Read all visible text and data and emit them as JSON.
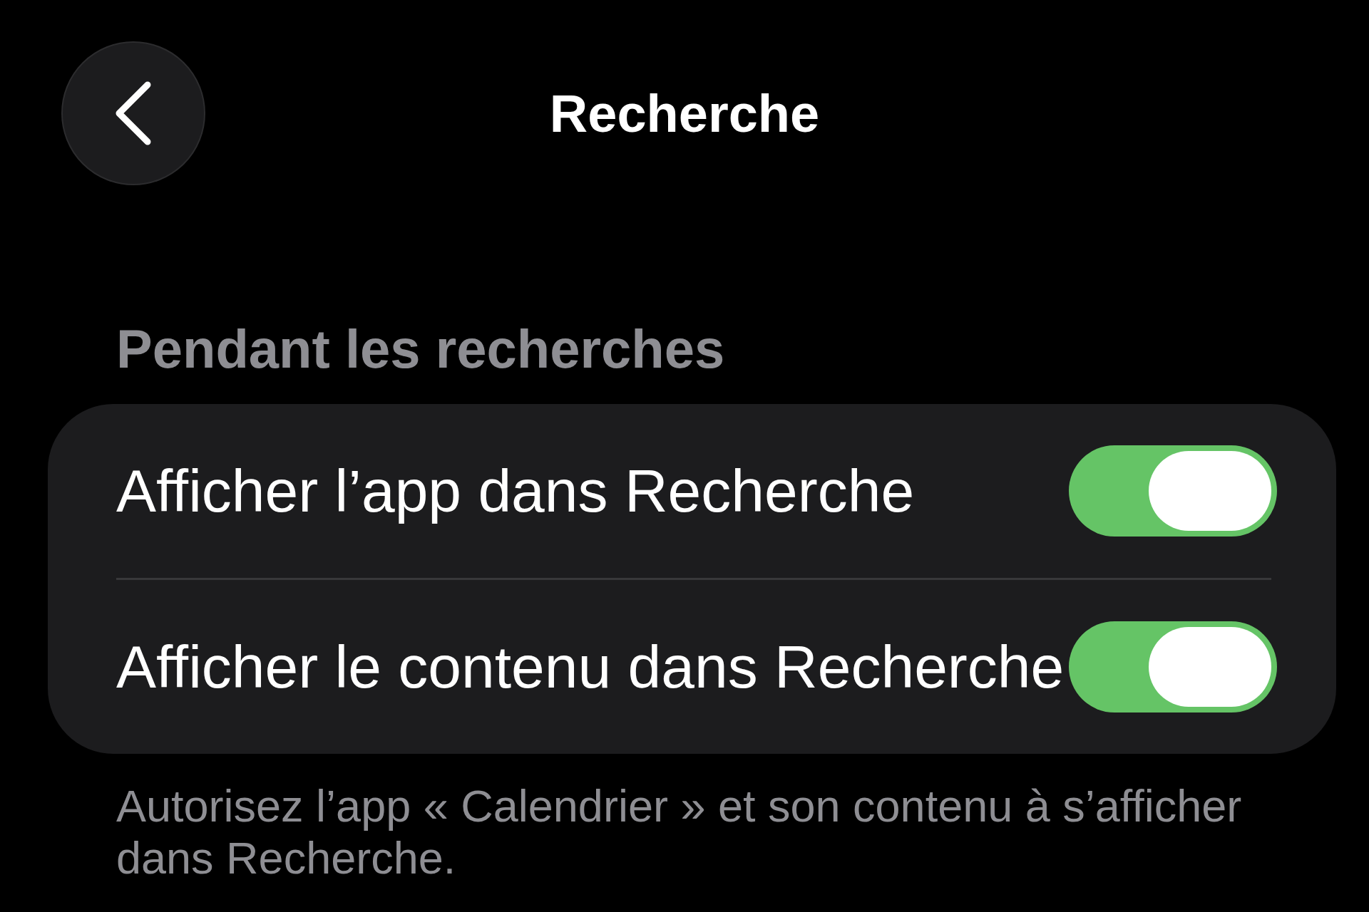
{
  "header": {
    "title": "Recherche"
  },
  "section": {
    "title": "Pendant les recherches",
    "rows": [
      {
        "label": "Afficher l’app dans Recherche",
        "on": true
      },
      {
        "label": "Afficher le contenu dans Recherche",
        "on": true
      }
    ],
    "footer": "Autorisez l’app « Calendrier » et son contenu à s’afficher dans Recherche."
  }
}
